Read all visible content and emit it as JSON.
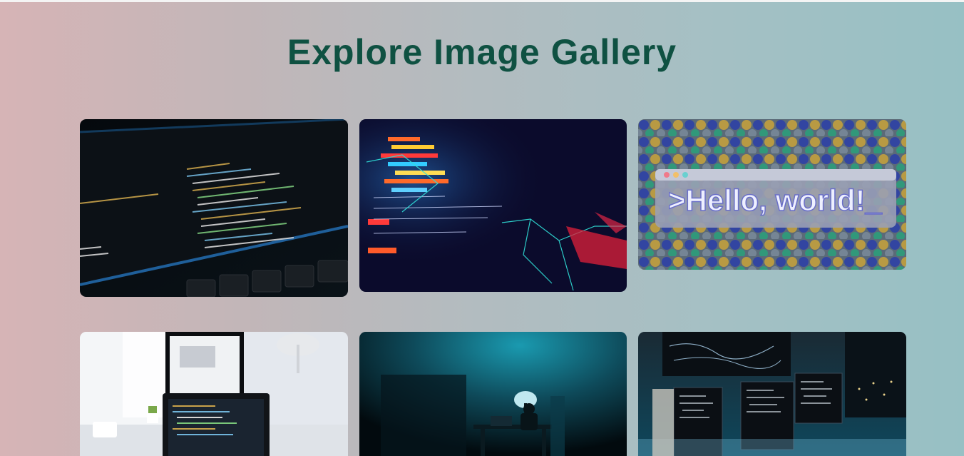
{
  "header": {
    "title": "Explore Image Gallery"
  },
  "gallery": {
    "images": [
      {
        "name": "laptop-code-editor-dark",
        "overlay_text": ""
      },
      {
        "name": "abstract-code-network",
        "overlay_text": ""
      },
      {
        "name": "hello-world-terminal",
        "overlay_text": ">Hello, world!_"
      },
      {
        "name": "bright-desk-laptop-code",
        "overlay_text": ""
      },
      {
        "name": "hacker-dark-room",
        "overlay_text": ""
      },
      {
        "name": "monitors-server-room",
        "overlay_text": ""
      }
    ]
  },
  "colors": {
    "title": "#0f5142",
    "background_left": "#d6b4b6",
    "background_right": "#97c0c4"
  }
}
